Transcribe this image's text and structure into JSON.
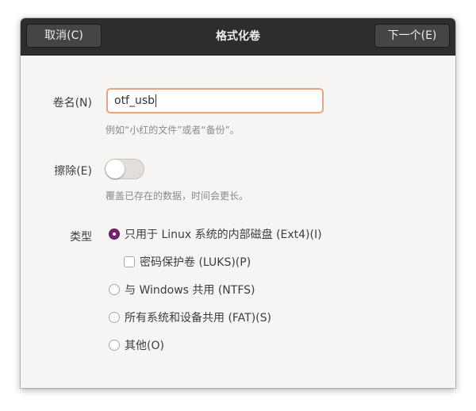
{
  "header": {
    "cancel_label": "取消(C)",
    "title": "格式化卷",
    "next_label": "下一个(E)"
  },
  "name": {
    "label": "卷名(N)",
    "value": "otf_usb",
    "hint": "例如“小红的文件”或者“备份”。"
  },
  "erase": {
    "label": "擦除(E)",
    "enabled": false,
    "hint": "覆盖已存在的数据，时间会更长。"
  },
  "type": {
    "label": "类型",
    "options": [
      {
        "label": "只用于 Linux 系统的内部磁盘 (Ext4)(I)",
        "selected": true
      },
      {
        "label": "密码保护卷 (LUKS)(P)",
        "checked": false
      },
      {
        "label": "与 Windows 共用 (NTFS)",
        "selected": false
      },
      {
        "label": "所有系统和设备共用 (FAT)(S)",
        "selected": false
      },
      {
        "label": "其他(O)",
        "selected": false
      }
    ]
  },
  "colors": {
    "headerbar": "#2d2d2d",
    "accent_radio": "#77216f",
    "focus_border": "#e9a37f"
  }
}
